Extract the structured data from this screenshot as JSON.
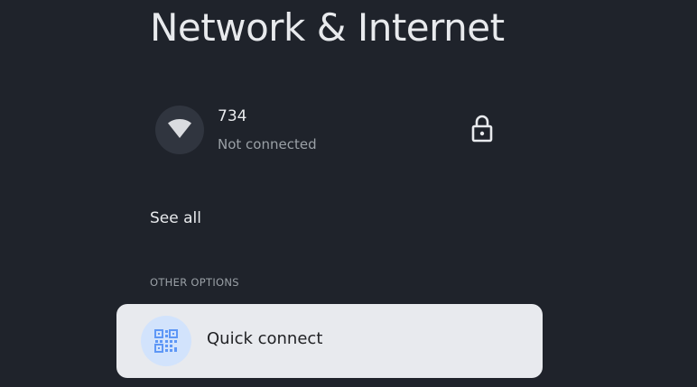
{
  "page": {
    "title": "Network & Internet"
  },
  "network": {
    "icon": "wifi-icon",
    "name": "734",
    "status": "Not connected",
    "secure_icon": "lock-icon"
  },
  "see_all_label": "See all",
  "other_options": {
    "heading": "OTHER OPTIONS",
    "items": [
      {
        "label": "Quick connect",
        "icon": "qr-code-icon"
      }
    ]
  },
  "colors": {
    "background": "#1f232b",
    "card_focused": "#e8eaee",
    "accent_blue": "#5e97f6"
  }
}
